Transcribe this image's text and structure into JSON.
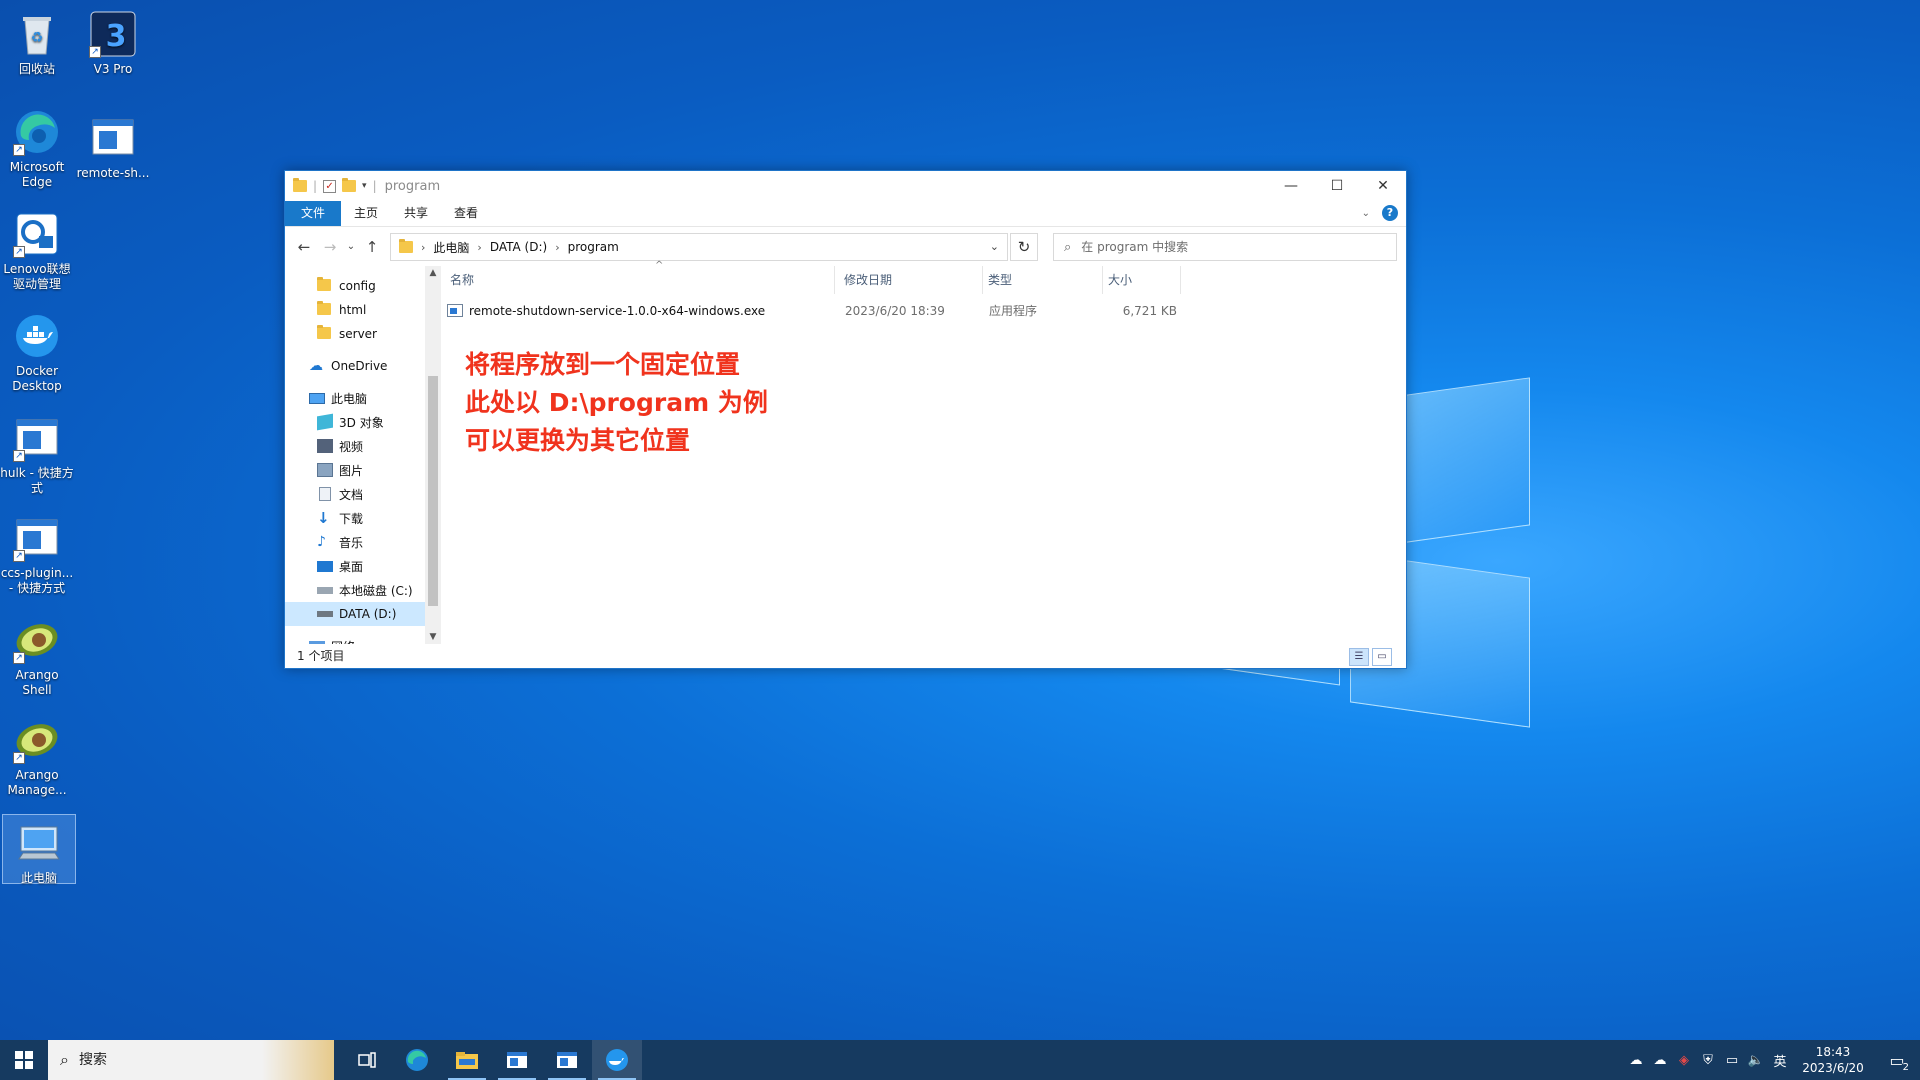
{
  "desktop": {
    "icons": [
      {
        "label": "回收站"
      },
      {
        "label": "V3 Pro"
      },
      {
        "label": "Microsoft Edge"
      },
      {
        "label": "remote-sh..."
      },
      {
        "label": "Lenovo联想驱动管理"
      },
      {
        "label": "Docker Desktop"
      },
      {
        "label": "hulk - 快捷方式"
      },
      {
        "label": "ccs-plugin... - 快捷方式"
      },
      {
        "label": "Arango Shell"
      },
      {
        "label": "Arango Manage..."
      },
      {
        "label": "此电脑"
      }
    ]
  },
  "explorer": {
    "title": "program",
    "ribbon_tabs": [
      "文件",
      "主页",
      "共享",
      "查看"
    ],
    "help": "?",
    "address": {
      "segments": [
        "此电脑",
        "DATA (D:)",
        "program"
      ]
    },
    "search": {
      "placeholder": "在 program 中搜索"
    },
    "nav_items": [
      {
        "label": "config"
      },
      {
        "label": "html"
      },
      {
        "label": "server"
      },
      {
        "label": "OneDrive"
      },
      {
        "label": "此电脑"
      },
      {
        "label": "3D 对象"
      },
      {
        "label": "视频"
      },
      {
        "label": "图片"
      },
      {
        "label": "文档"
      },
      {
        "label": "下载"
      },
      {
        "label": "音乐"
      },
      {
        "label": "桌面"
      },
      {
        "label": "本地磁盘 (C:)"
      },
      {
        "label": "DATA (D:)"
      },
      {
        "label": "网络"
      }
    ],
    "columns": [
      "名称",
      "修改日期",
      "类型",
      "大小"
    ],
    "files": [
      {
        "name": "remote-shutdown-service-1.0.0-x64-windows.exe",
        "modified": "2023/6/20 18:39",
        "type": "应用程序",
        "size": "6,721 KB"
      }
    ],
    "annotation": [
      "将程序放到一个固定位置",
      "此处以 D:\\program 为例",
      "可以更换为其它位置"
    ],
    "status": "1 个项目"
  },
  "taskbar": {
    "search_placeholder": "搜索",
    "clock_time": "18:43",
    "clock_date": "2023/6/20",
    "ime": "英",
    "notification_count": "2"
  },
  "colors": {
    "accent": "#1979ca",
    "annotation": "#f0331d",
    "taskbar": "#163a60"
  }
}
